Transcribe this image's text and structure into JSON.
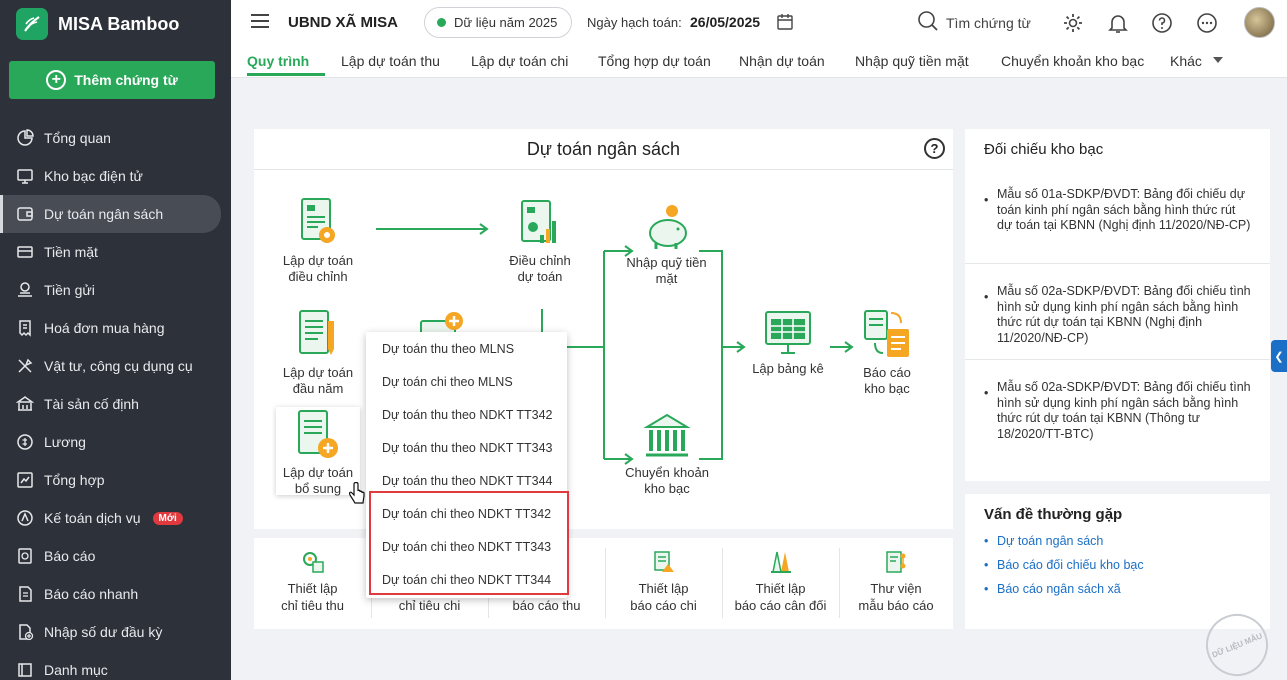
{
  "app": {
    "name": "MISA Bamboo",
    "add_button": "Thêm chứng từ"
  },
  "sidebar": {
    "items": [
      {
        "label": "Tổng quan",
        "icon": "chart-pie-icon"
      },
      {
        "label": "Kho bạc điện tử",
        "icon": "monitor-icon"
      },
      {
        "label": "Dự toán ngân sách",
        "icon": "budget-icon",
        "active": true
      },
      {
        "label": "Tiền mặt",
        "icon": "cash-icon"
      },
      {
        "label": "Tiền gửi",
        "icon": "deposit-icon"
      },
      {
        "label": "Hoá đơn mua hàng",
        "icon": "invoice-icon"
      },
      {
        "label": "Vật tư, công cụ dụng cụ",
        "icon": "tools-icon"
      },
      {
        "label": "Tài sản cố định",
        "icon": "building-icon"
      },
      {
        "label": "Lương",
        "icon": "salary-icon"
      },
      {
        "label": "Tổng hợp",
        "icon": "summary-icon"
      },
      {
        "label": "Kế toán dịch vụ",
        "icon": "service-icon",
        "badge": "Mới"
      },
      {
        "label": "Báo cáo",
        "icon": "report-icon"
      },
      {
        "label": "Báo cáo nhanh",
        "icon": "quick-report-icon"
      },
      {
        "label": "Nhập số dư đầu kỳ",
        "icon": "import-icon"
      },
      {
        "label": "Danh mục",
        "icon": "catalog-icon"
      }
    ]
  },
  "topbar": {
    "org_name": "UBND XÃ MISA",
    "data_year": "Dữ liệu năm 2025",
    "date_label": "Ngày hạch toán:",
    "date_value": "26/05/2025",
    "search_label": "Tìm chứng từ"
  },
  "tabs": [
    "Quy trình",
    "Lập dự toán thu",
    "Lập dự toán chi",
    "Tổng hợp dự toán",
    "Nhận dự toán",
    "Nhập quỹ tiền mặt",
    "Chuyển khoản kho bạc",
    "Khác"
  ],
  "process": {
    "title": "Dự toán ngân sách",
    "nodes": {
      "adjust_plan": "Lập dự toán điều chỉnh",
      "adjust": "Điều chỉnh dự toán",
      "cash_in": "Nhập quỹ tiền mặt",
      "initial_plan": "Lập dự toán đầu năm",
      "supplement_plan": "Lập dự toán bổ sung",
      "statement": "Lập bảng kê",
      "treasury_report": "Báo cáo kho bạc",
      "transfer": "Chuyển khoản kho bạc"
    }
  },
  "dropdown": {
    "items": [
      "Dự toán thu theo MLNS",
      "Dự toán chi theo MLNS",
      "Dự toán thu theo NDKT TT342",
      "Dự toán thu theo NDKT TT343",
      "Dự toán thu theo NDKT TT344",
      "Dự toán chi theo NDKT TT342",
      "Dự toán chi theo NDKT TT343",
      "Dự toán chi theo NDKT TT344"
    ]
  },
  "tools": [
    {
      "label1": "Thiết lập",
      "label2": "chỉ tiêu thu"
    },
    {
      "label1": "",
      "label2": "chỉ tiêu chi"
    },
    {
      "label1": "",
      "label2": "báo cáo thu"
    },
    {
      "label1": "Thiết lập",
      "label2": "báo cáo chi"
    },
    {
      "label1": "Thiết lập",
      "label2": "báo cáo cân đối"
    },
    {
      "label1": "Thư viện",
      "label2": "mẫu báo cáo"
    }
  ],
  "reconcile": {
    "title": "Đối chiếu kho bạc",
    "items": [
      "Mẫu số 01a-SDKP/ĐVDT: Bảng đối chiếu dự toán kinh phí ngân sách bằng hình thức rút dự toán tại KBNN (Nghị định 11/2020/NĐ-CP)",
      "Mẫu số 02a-SDKP/ĐVDT: Bảng đối chiếu tình hình sử dụng kinh phí ngân sách bằng hình thức rút dự toán tại KBNN (Nghị định 11/2020/NĐ-CP)",
      "Mẫu số 02a-SDKP/ĐVDT: Bảng đối chiếu tình hình sử dụng kinh phí ngân sách bằng hình thức rút dự toán tại KBNN (Thông tư 18/2020/TT-BTC)"
    ]
  },
  "faq": {
    "title": "Vấn đề thường gặp",
    "items": [
      "Dự toán ngân sách",
      "Báo cáo đối chiếu kho bạc",
      "Báo cáo ngân sách xã"
    ]
  },
  "watermark": "DỮ LIỆU MẪU",
  "colors": {
    "accent": "#2aa85a",
    "sidebar_bg": "#2d3139",
    "highlight": "#e0393e",
    "link": "#1b6fc6"
  }
}
